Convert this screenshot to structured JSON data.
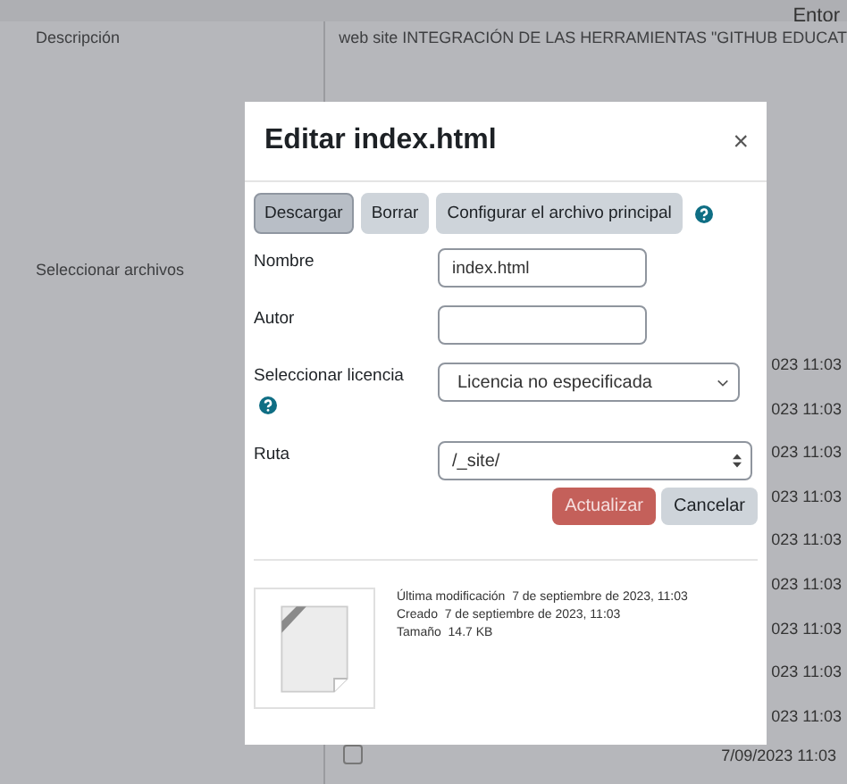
{
  "header": {
    "user": "Entor"
  },
  "background": {
    "description_label": "Descripción",
    "description_value": "web site INTEGRACIÓN DE LAS HERRAMIENTAS \"GITHUB EDUCAT",
    "files_label": "Seleccionar archivos",
    "dates": [
      "023 11:03",
      "023 11:03",
      "023 11:03",
      "023 11:03",
      "023 11:03",
      "023 11:03",
      "023 11:03",
      "023 11:03",
      "023 11:03"
    ],
    "last_date": "7/09/2023 11:03",
    "last_checked": false
  },
  "dialog": {
    "title": "Editar index.html",
    "close": "×",
    "actions": [
      {
        "label": "Descargar",
        "selected": true
      },
      {
        "label": "Borrar",
        "selected": false
      },
      {
        "label": "Configurar el archivo principal",
        "selected": false
      }
    ],
    "fields": [
      {
        "kind": "text",
        "label": "Nombre",
        "value": "index.html"
      },
      {
        "kind": "text",
        "label": "Autor"
      },
      {
        "kind": "select",
        "label": "Seleccionar licencia",
        "value": "Licencia no especificada",
        "help": true
      },
      {
        "kind": "path",
        "label": "Ruta",
        "value": "/_site/"
      }
    ],
    "buttons": [
      {
        "label": "Actualizar",
        "kind": "primary"
      },
      {
        "label": "Cancelar",
        "kind": "secondary"
      }
    ],
    "info": [
      {
        "label": "Última modificación",
        "value": "7 de septiembre de 2023, 11:03"
      },
      {
        "label": "Creado",
        "value": "7 de septiembre de 2023, 11:03"
      },
      {
        "label": "Tamaño",
        "value": "14.7 KB"
      }
    ]
  }
}
